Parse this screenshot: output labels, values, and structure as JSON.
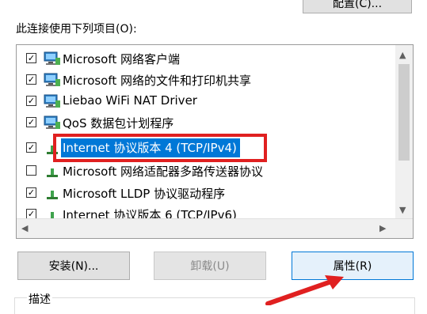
{
  "buttons": {
    "configure": "配置(C)...",
    "install": "安装(N)...",
    "uninstall": "卸载(U)",
    "properties": "属性(R)"
  },
  "connection_label": "此连接使用下列项目(O):",
  "items": [
    {
      "label": "Microsoft 网络客户端",
      "checked": true,
      "icon": "network-client-icon"
    },
    {
      "label": "Microsoft 网络的文件和打印机共享",
      "checked": true,
      "icon": "network-client-icon"
    },
    {
      "label": "Liebao WiFi NAT Driver",
      "checked": true,
      "icon": "network-client-icon"
    },
    {
      "label": "QoS 数据包计划程序",
      "checked": true,
      "icon": "network-client-icon"
    },
    {
      "label": "Internet 协议版本 4 (TCP/IPv4)",
      "checked": true,
      "icon": "protocol-icon",
      "selected": true
    },
    {
      "label": "Microsoft 网络适配器多路传送器协议",
      "checked": false,
      "icon": "protocol-icon"
    },
    {
      "label": "Microsoft LLDP 协议驱动程序",
      "checked": true,
      "icon": "protocol-icon"
    },
    {
      "label": "Internet 协议版本 6 (TCP/IPv6)",
      "checked": true,
      "icon": "protocol-icon"
    }
  ],
  "description_label": "描述",
  "colors": {
    "selection": "#0078d7",
    "highlight_box": "#e02020"
  }
}
